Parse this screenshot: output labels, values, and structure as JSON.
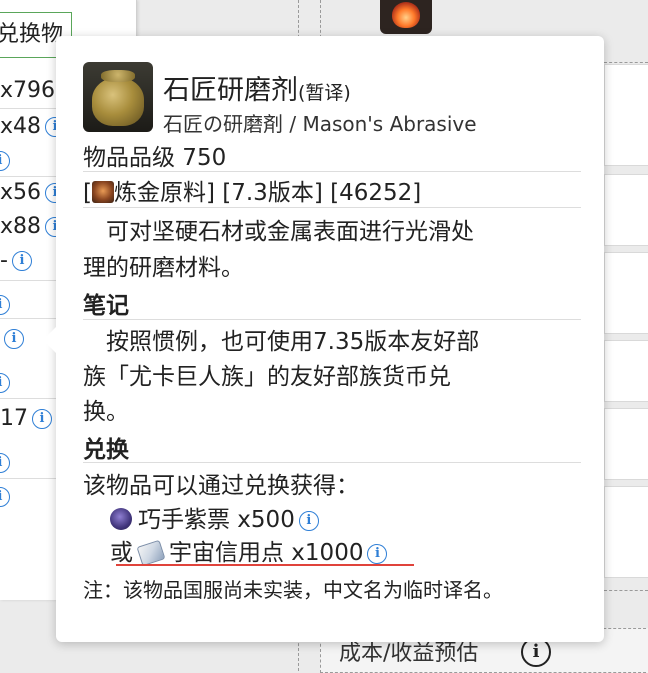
{
  "background": {
    "tab_label": "兑换物",
    "rows": [
      {
        "text": "x796",
        "info": false
      },
      {
        "text": "x48",
        "info": true
      },
      {
        "text": "",
        "info": true
      },
      {
        "text": "x56",
        "info": true
      },
      {
        "text": "x88",
        "info": true
      },
      {
        "text": "-",
        "info": true
      },
      {
        "text": "",
        "info": true
      },
      {
        "text": "",
        "info": true
      },
      {
        "text": "",
        "info": true
      },
      {
        "text": "17",
        "info": true
      },
      {
        "text": "",
        "info": true
      },
      {
        "text": "",
        "info": true
      }
    ],
    "footer_label": "成本/收益预估",
    "info_glyph": "i"
  },
  "tooltip": {
    "item_name": "石匠研磨剂",
    "name_note": "(暂译)",
    "subtitle": "石匠の研磨剤 / Mason's Abrasive",
    "item_level": "物品品级 750",
    "category_open": "[",
    "category": "炼金原料] [7.3版本] [46252]",
    "description_1": "　可对坚硬石材或金属表面进行光滑处",
    "description_2": "理的研磨材料。",
    "notes_heading": "笔记",
    "notes_1": "　按照惯例，也可使用7.35版本友好部",
    "notes_2": "族「尤卡巨人族」的友好部族货币兑",
    "notes_3": "换。",
    "exchange_heading": "兑换",
    "exchange_intro": "该物品可以通过兑换获得：",
    "exchange_option_1": "巧手紫票 x500",
    "exchange_or": "或",
    "exchange_option_2": "宇宙信用点 x1000",
    "footnote": "注：该物品国服尚未实装，中文名为临时译名。",
    "icons": {
      "item": "abrasive-pot-icon",
      "category": "alchemy-icon",
      "currency_1": "purple-scrip-icon",
      "currency_2": "cosmic-credit-icon"
    },
    "colors": {
      "info_blue": "#2f7fd6",
      "underline_red": "#e0433b"
    }
  }
}
